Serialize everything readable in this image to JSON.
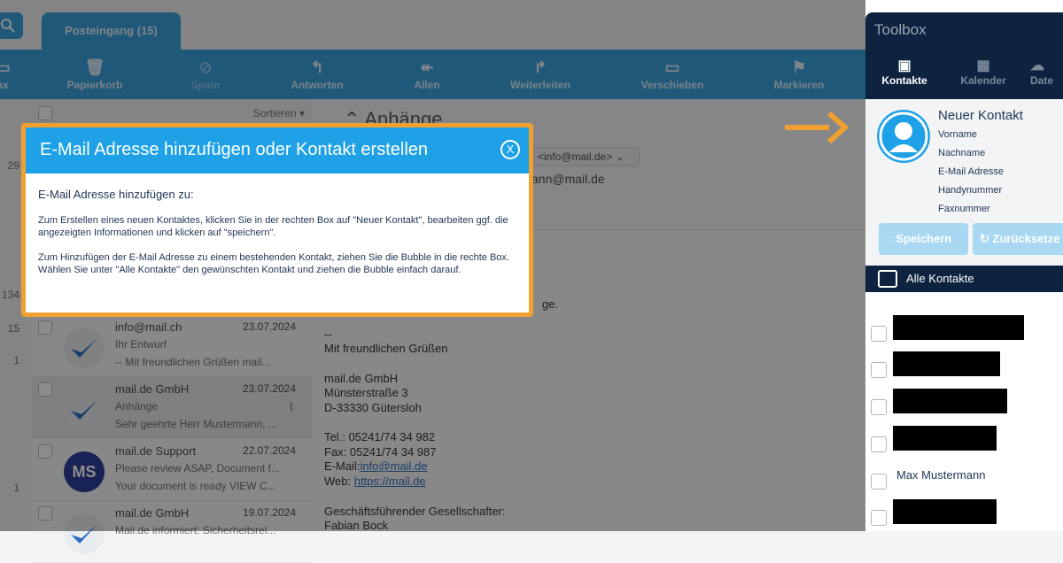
{
  "inbox_tab": "Posteingang (15)",
  "toolbar": [
    {
      "label": "ax",
      "icon": "print-icon",
      "disabled": false
    },
    {
      "label": "Papierkorb",
      "icon": "trash-icon",
      "disabled": false
    },
    {
      "label": "Spam",
      "icon": "spam-icon",
      "disabled": true
    },
    {
      "label": "Antworten",
      "icon": "reply-icon",
      "disabled": false
    },
    {
      "label": "Allen",
      "icon": "reply-all-icon",
      "disabled": false
    },
    {
      "label": "Weiterleiten",
      "icon": "forward-icon",
      "disabled": false
    },
    {
      "label": "Verschieben",
      "icon": "folder-icon",
      "disabled": false
    },
    {
      "label": "Markieren",
      "icon": "flag-icon",
      "disabled": false
    }
  ],
  "left_numbers": [
    "29",
    "134",
    "15",
    "1",
    "1"
  ],
  "list": {
    "sort_label": "Sortieren",
    "items": [
      {
        "from": "info@mail.ch",
        "date": "23.07.2024",
        "subject": "Ihr Entwurf",
        "preview": "-- Mit freundlichen Grüßen mail...",
        "avatar": "check",
        "selected": false
      },
      {
        "from": "mail.de GmbH",
        "date": "23.07.2024",
        "subject": "Anhänge",
        "preview": "Sehr geehrte Herr Mustermann, ...",
        "avatar": "check",
        "selected": true,
        "attachment": true
      },
      {
        "from": "mail.de Support",
        "date": "22.07.2024",
        "subject": "Please review ASAP, Document f...",
        "preview": "Your document is ready VIEW C...",
        "avatar": "MS",
        "selected": false
      },
      {
        "from": "mail.de GmbH",
        "date": "19.07.2024",
        "subject": "Mail.de informiert: Sicherheitsrel...",
        "preview": "",
        "avatar": "check",
        "selected": false
      }
    ]
  },
  "content": {
    "title": "Anhänge",
    "address_chip": "<info@mail.de>",
    "address_line": "ann@mail.de",
    "body_fragment": "ge.",
    "signature": [
      "--",
      "Mit freundlichen Grüßen",
      "",
      "mail.de GmbH",
      "Münsterstraße 3",
      "D-33330 Gütersloh",
      "",
      "Tel.: 05241/74 34 982",
      "Fax: 05241/74 34 987"
    ],
    "email_label": "E-Mail:",
    "email_link": "info@mail.de",
    "web_label": "Web: ",
    "web_link": "https://mail.de",
    "ceo_label": "Geschäftsführender Gesellschafter:",
    "ceo_name": "Fabian Bock"
  },
  "modal": {
    "title": "E-Mail Adresse hinzufügen oder Kontakt erstellen",
    "close": "X",
    "subtitle": "E-Mail Adresse hinzufügen zu:",
    "para1": "Zum Erstellen eines neuen Kontaktes, klicken Sie in der rechten Box auf \"Neuer Kontakt\", bearbeiten ggf. die angezeigten Informationen und klicken auf \"speichern\".",
    "para2": "Zum Hinzufügen der E-Mail Adresse zu einem bestehenden Kontakt, ziehen Sie die Bubble in die rechte Box. Wählen Sie unter \"Alle Kontakte\" den gewünschten Kontakt und ziehen die Bubble einfach darauf."
  },
  "toolbox": {
    "title": "Toolbox",
    "tabs": [
      {
        "label": "Kontakte",
        "icon": "contacts-icon",
        "active": true
      },
      {
        "label": "Kalender",
        "icon": "calendar-icon",
        "active": false
      },
      {
        "label": "Date",
        "icon": "cloud-icon",
        "active": false
      }
    ],
    "new_contact": {
      "title": "Neuer Kontakt",
      "fields": [
        "Vorname",
        "Nachname",
        "E-Mail Adresse",
        "Handynummer",
        "Faxnummer"
      ],
      "save": "Speichern",
      "reset": "Zurücksetze"
    },
    "all_contacts": "Alle Kontakte",
    "contacts": [
      {
        "name": "",
        "redacted": true
      },
      {
        "name": "",
        "redacted": true
      },
      {
        "name": "",
        "redacted": true
      },
      {
        "name": "",
        "redacted": true
      },
      {
        "name": "Max Mustermann",
        "redacted": false
      },
      {
        "name": "",
        "redacted": true
      }
    ]
  },
  "colors": {
    "accent": "#3ba0dc",
    "modal_border": "#f0a030",
    "modal_header": "#1ea1e6",
    "toolbox_dark": "#0d2340"
  }
}
